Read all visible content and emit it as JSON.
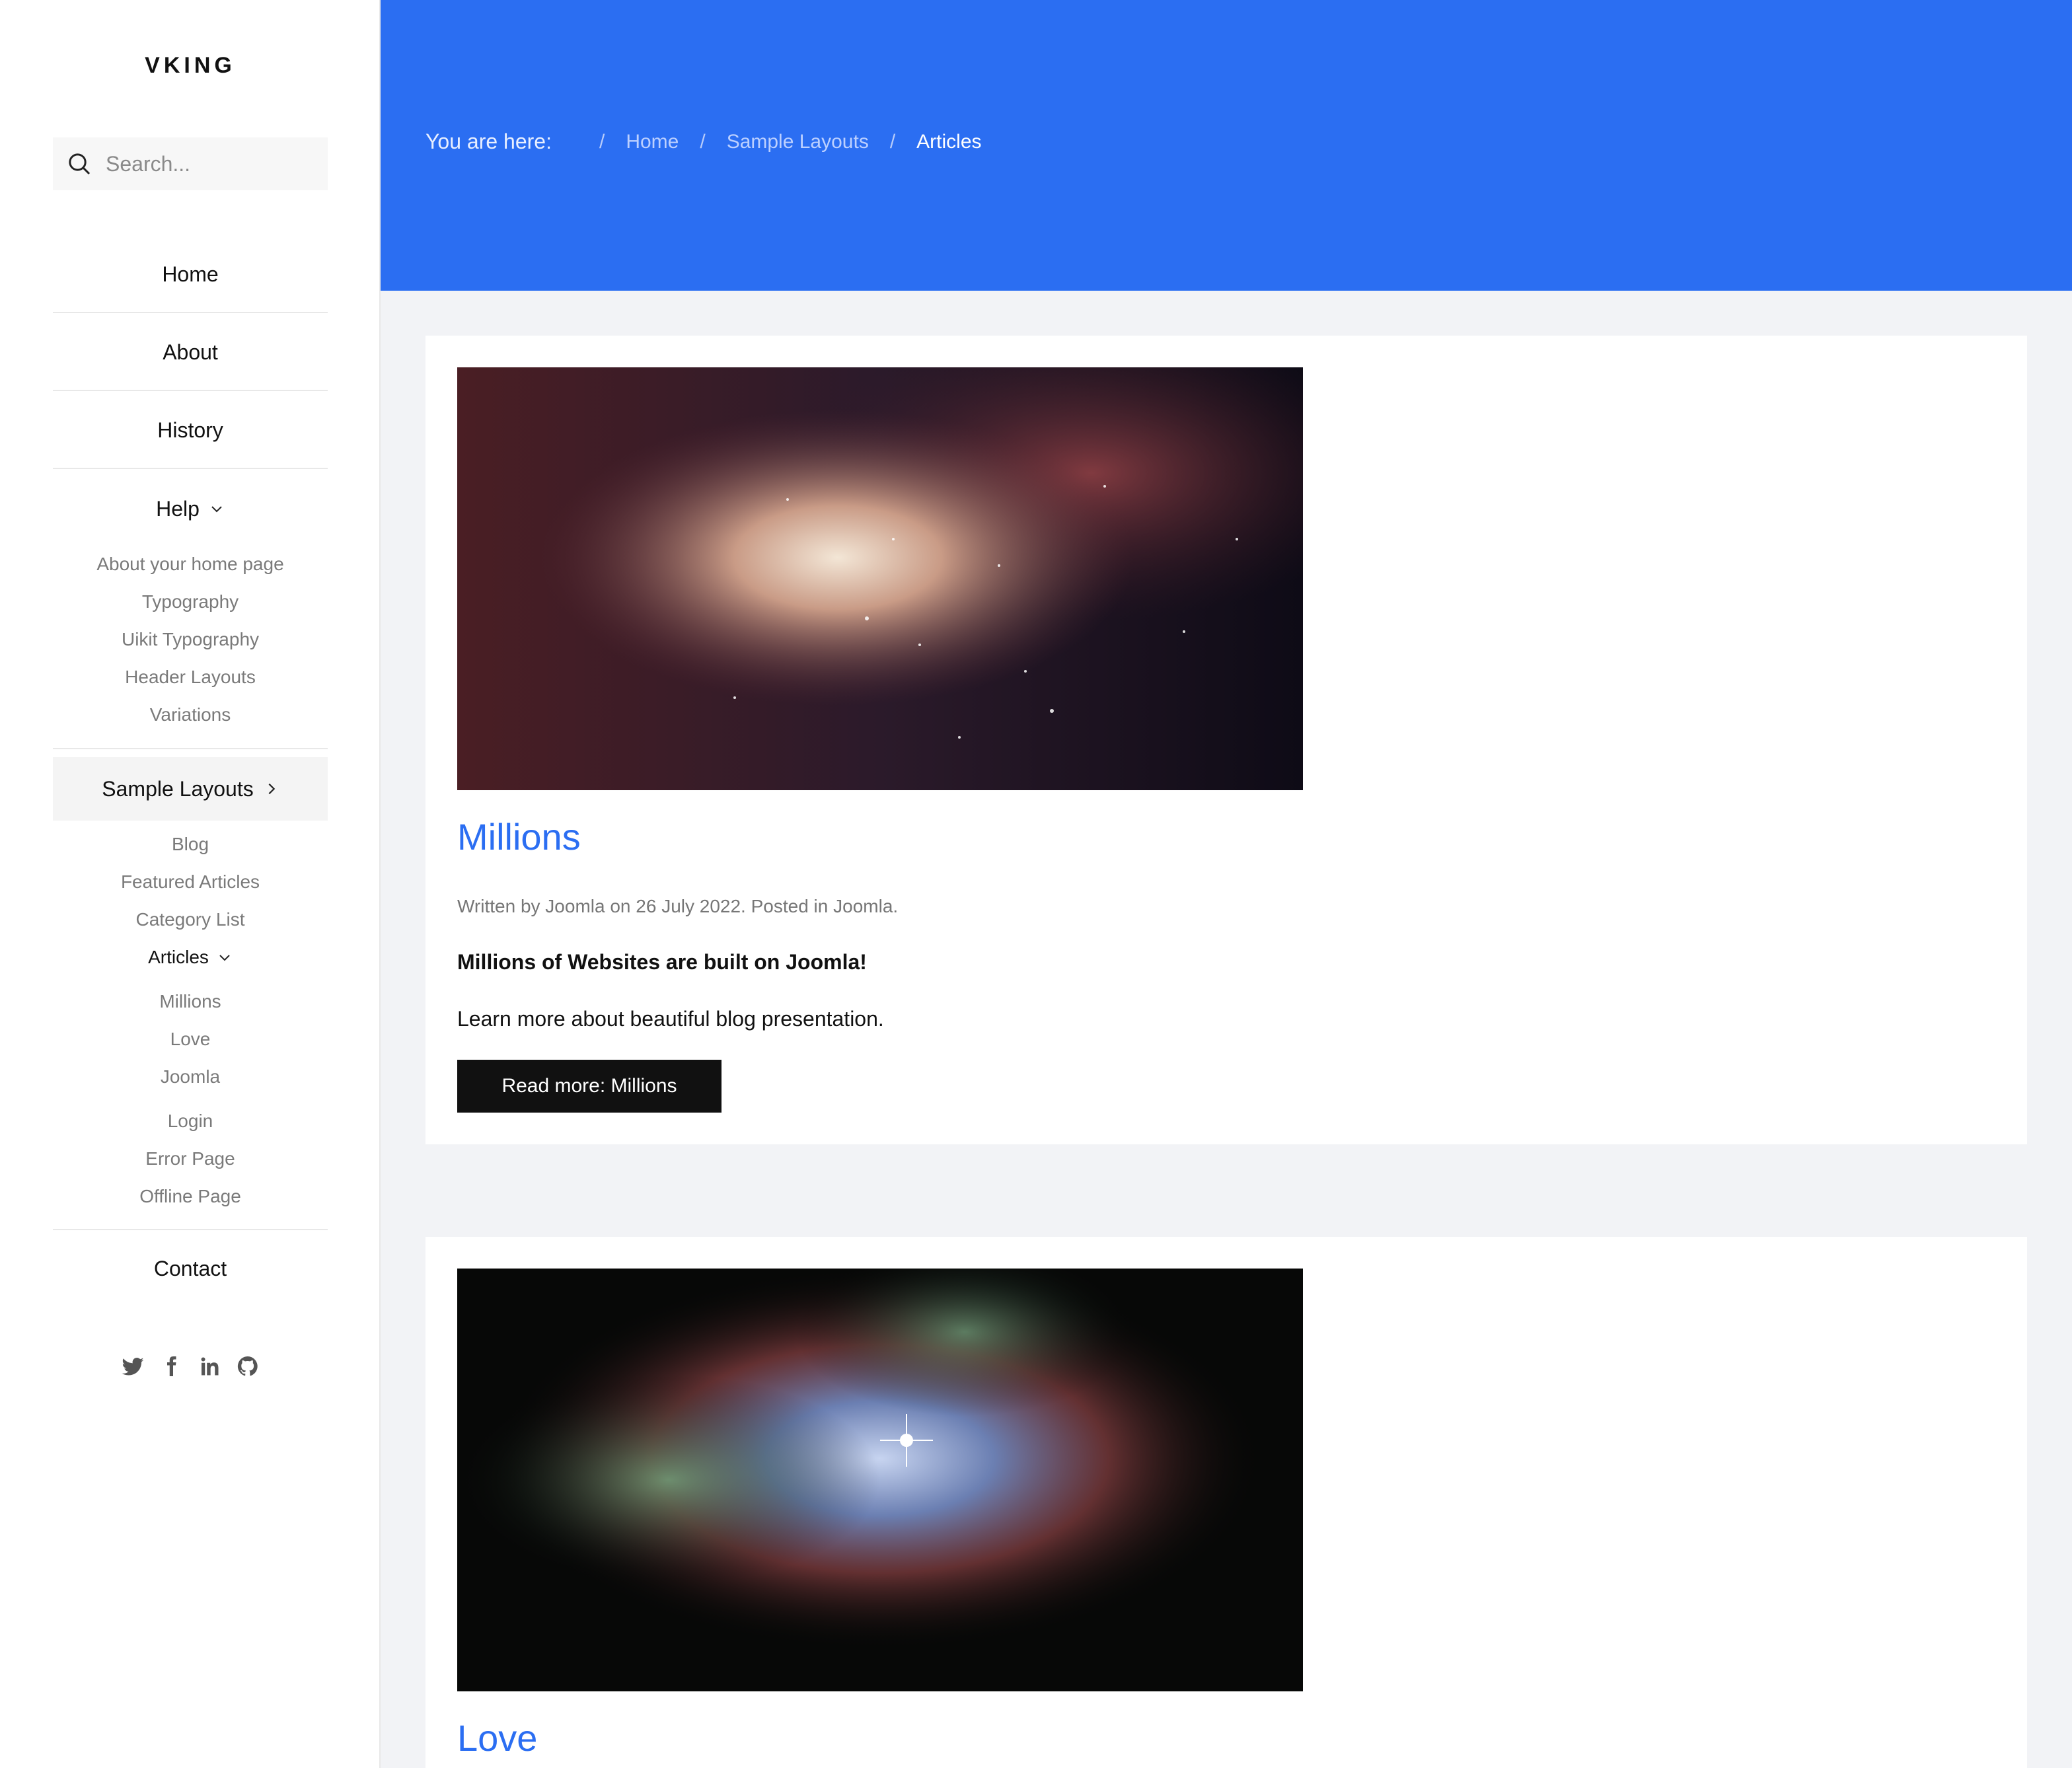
{
  "brand": "VKING",
  "search": {
    "placeholder": "Search..."
  },
  "nav": {
    "home": "Home",
    "about": "About",
    "history": "History",
    "help": "Help",
    "help_items": [
      "About your home page",
      "Typography",
      "Uikit Typography",
      "Header Layouts",
      "Variations"
    ],
    "sample_layouts": "Sample Layouts",
    "sample_items": [
      "Blog",
      "Featured Articles",
      "Category List"
    ],
    "articles": "Articles",
    "article_items": [
      "Millions",
      "Love",
      "Joomla"
    ],
    "extra_items": [
      "Login",
      "Error Page",
      "Offline Page"
    ],
    "contact": "Contact"
  },
  "social": [
    "twitter-icon",
    "facebook-icon",
    "linkedin-icon",
    "github-icon"
  ],
  "breadcrumb": {
    "label": "You are here:",
    "items": [
      "Home",
      "Sample Layouts",
      "Articles"
    ]
  },
  "articles": [
    {
      "title": "Millions",
      "meta": "Written by Joomla on 26 July 2022. Posted in Joomla.",
      "lead": "Millions of Websites are built on Joomla!",
      "body": "Learn more about beautiful blog presentation.",
      "button": "Read more: Millions"
    },
    {
      "title": "Love"
    }
  ],
  "colors": {
    "accent": "#2b6ef2",
    "button": "#111111"
  }
}
